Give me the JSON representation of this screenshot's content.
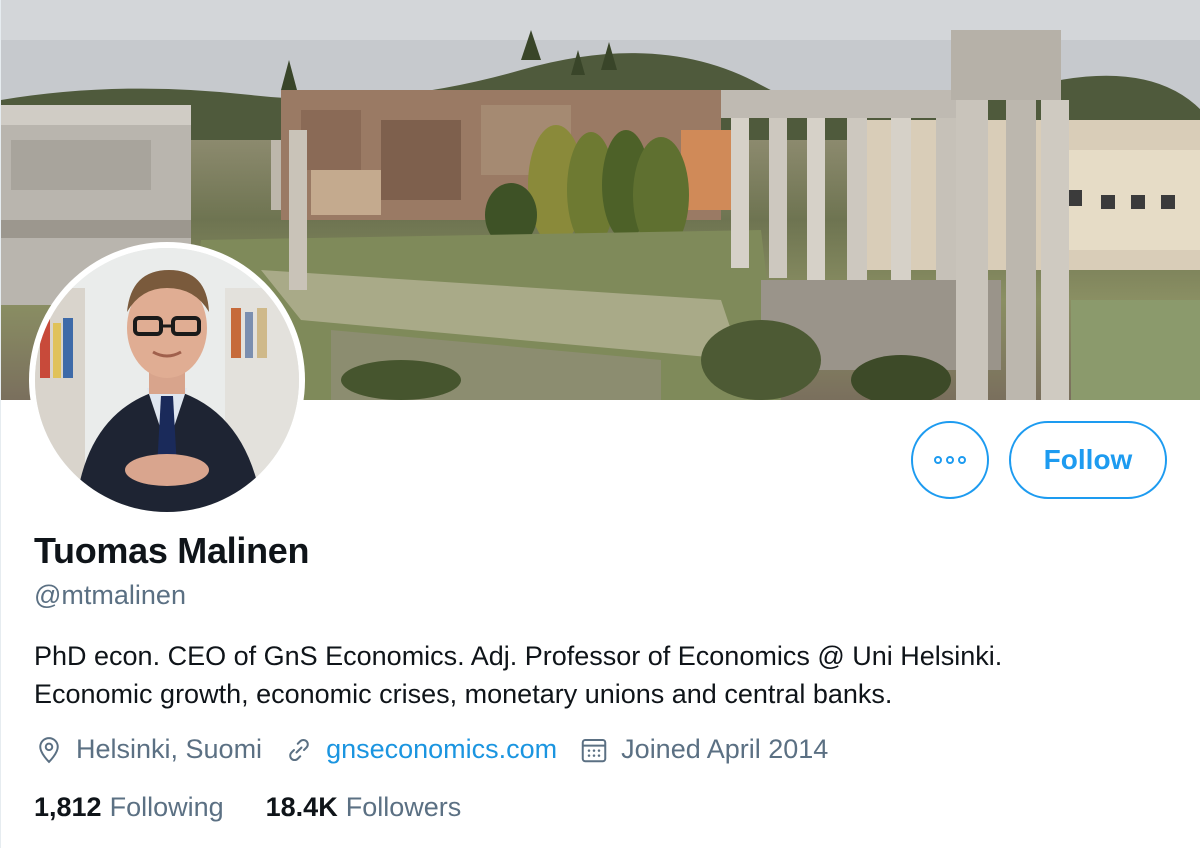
{
  "banner": {
    "icon": "roman-forum-photo"
  },
  "avatar": {
    "icon": "profile-photo"
  },
  "actions": {
    "more_icon": "more-horizontal-icon",
    "follow_label": "Follow"
  },
  "profile": {
    "display_name": "Tuomas Malinen",
    "handle": "@mtmalinen",
    "bio_line1": "PhD econ. CEO of GnS Economics. Adj. Professor of Economics @ Uni Helsinki.",
    "bio_line2": "Economic growth, economic crises, monetary unions and central banks.",
    "location": "Helsinki, Suomi",
    "website": "gnseconomics.com",
    "joined": "Joined April 2014"
  },
  "stats": {
    "following_count": "1,812",
    "following_label": "Following",
    "followers_count": "18.4K",
    "followers_label": "Followers"
  },
  "colors": {
    "accent": "#1d9bf0",
    "secondary_text": "#5b7083",
    "link": "#1b95e0"
  }
}
